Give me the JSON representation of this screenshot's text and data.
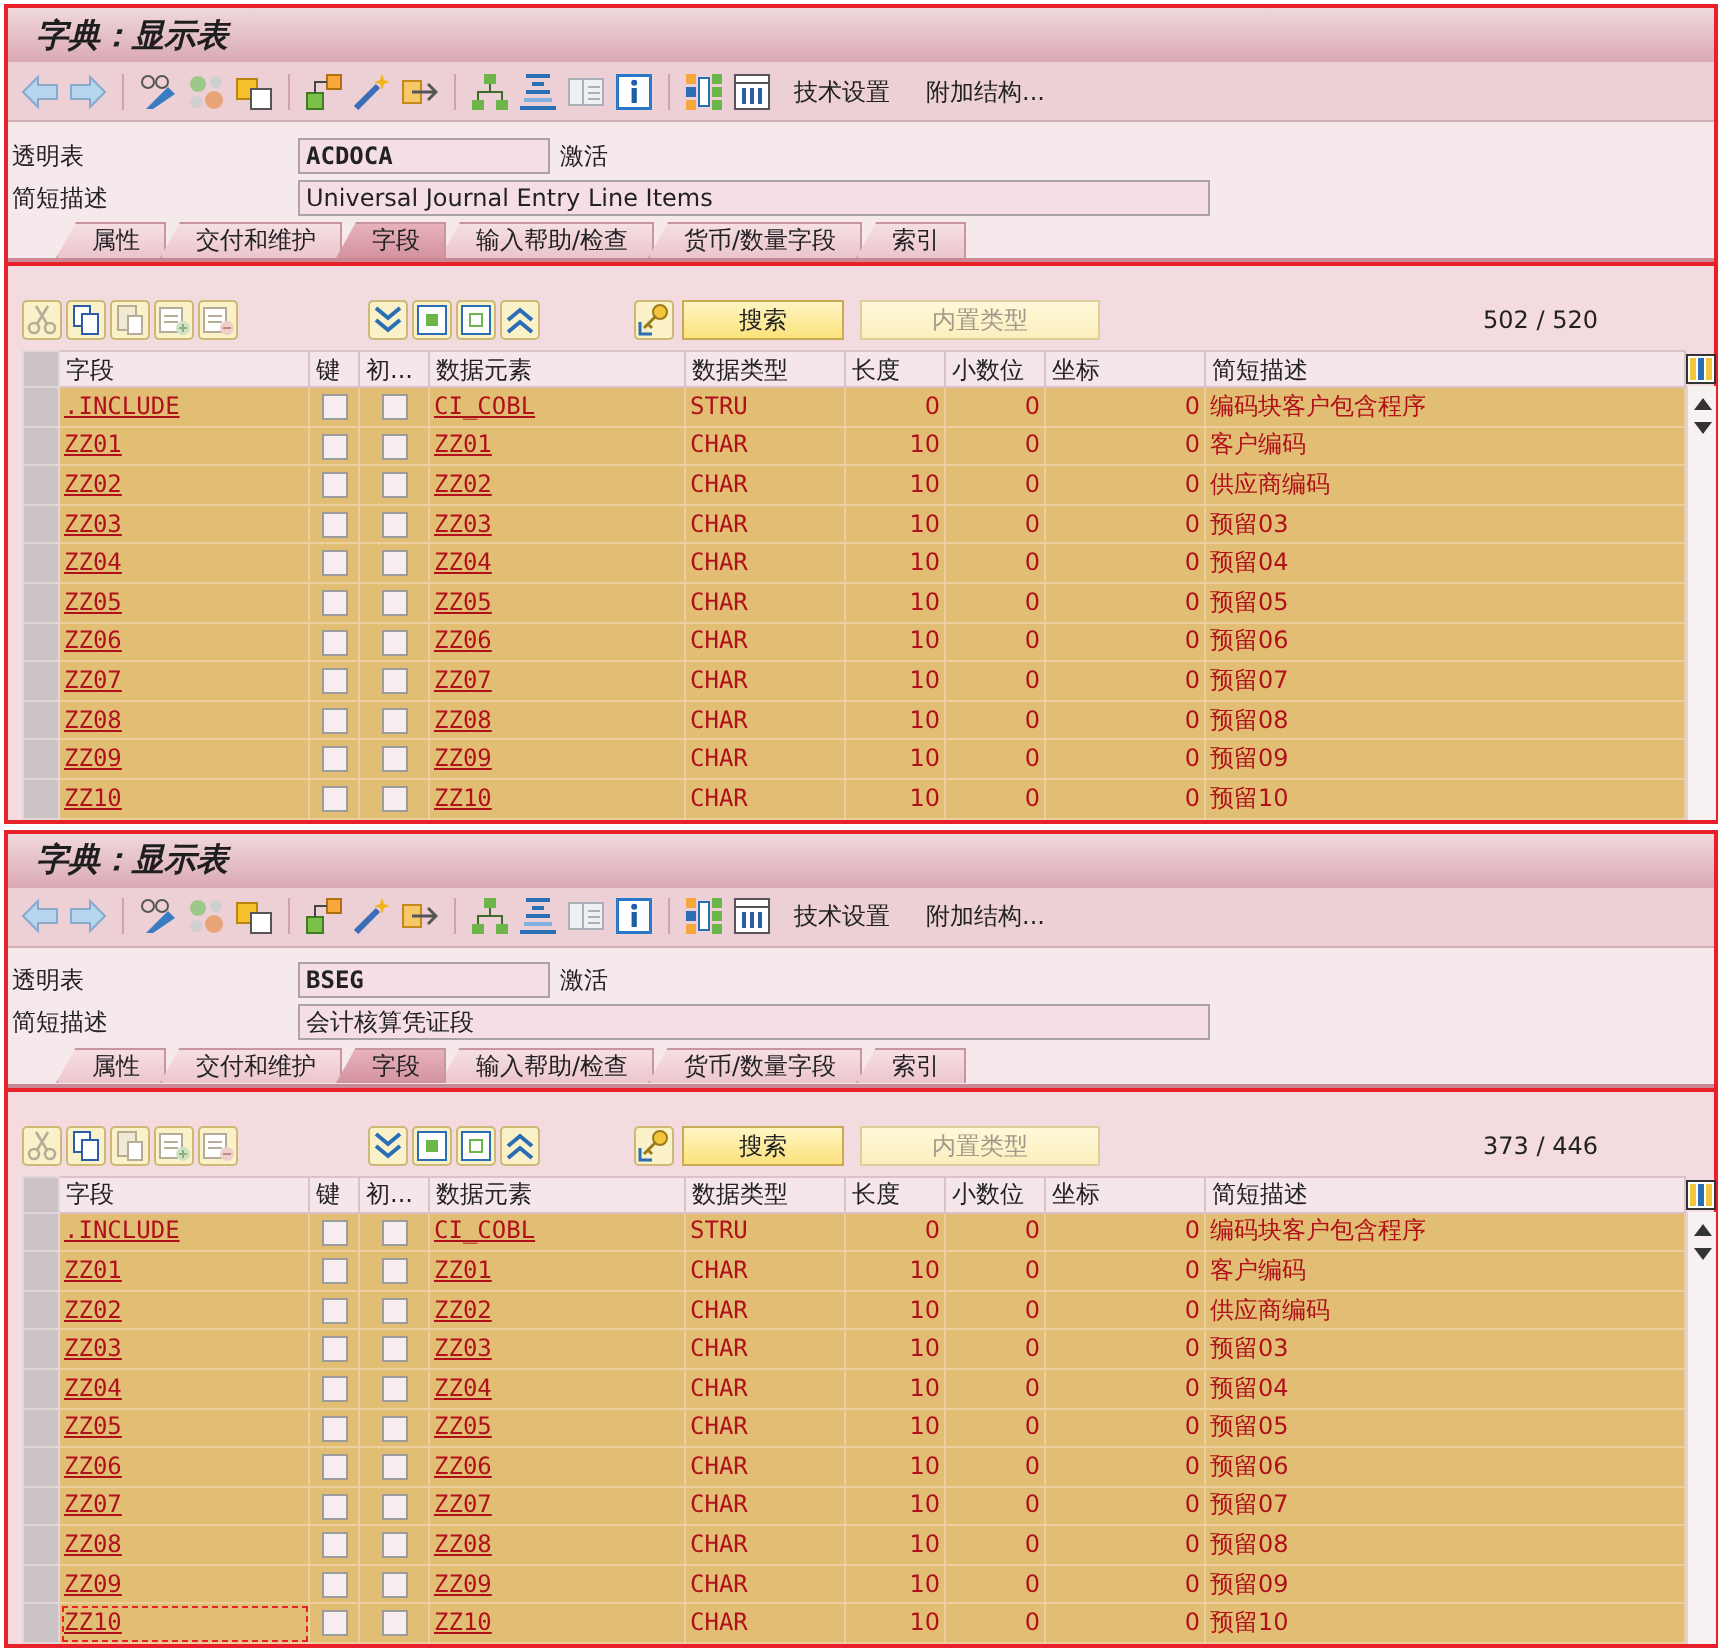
{
  "panels": [
    {
      "window": {
        "title": "字典：显示表"
      },
      "toolbar": {
        "text_buttons": [
          "技术设置",
          "附加结构..."
        ]
      },
      "header": {
        "table_label": "透明表",
        "table_name": "ACDOCA",
        "status": "激活",
        "description_label": "简短描述",
        "description": "Universal Journal Entry Line Items"
      },
      "tabs": [
        {
          "label": "属性",
          "selected": false
        },
        {
          "label": "交付和维护",
          "selected": false
        },
        {
          "label": "字段",
          "selected": true
        },
        {
          "label": "输入帮助/检查",
          "selected": false
        },
        {
          "label": "货币/数量字段",
          "selected": false
        },
        {
          "label": "索引",
          "selected": false
        }
      ],
      "fields_toolbar": {
        "search_button": "搜索",
        "builtin_type_button": {
          "label": "内置类型",
          "disabled": true
        },
        "count": "502 / 520"
      },
      "table": {
        "columns": [
          "字段",
          "键",
          "初...",
          "数据元素",
          "数据类型",
          "长度",
          "小数位",
          "坐标",
          "简短描述"
        ],
        "rows": [
          {
            "field": ".INCLUDE",
            "key": false,
            "initial": false,
            "data_element": "CI_COBL",
            "data_type": "STRU",
            "length": "0",
            "decimals": "0",
            "coordinate": "0",
            "description": "编码块客户包含程序",
            "focused": false
          },
          {
            "field": "ZZ01",
            "key": false,
            "initial": false,
            "data_element": "ZZ01",
            "data_type": "CHAR",
            "length": "10",
            "decimals": "0",
            "coordinate": "0",
            "description": "客户编码",
            "focused": false
          },
          {
            "field": "ZZ02",
            "key": false,
            "initial": false,
            "data_element": "ZZ02",
            "data_type": "CHAR",
            "length": "10",
            "decimals": "0",
            "coordinate": "0",
            "description": "供应商编码",
            "focused": false
          },
          {
            "field": "ZZ03",
            "key": false,
            "initial": false,
            "data_element": "ZZ03",
            "data_type": "CHAR",
            "length": "10",
            "decimals": "0",
            "coordinate": "0",
            "description": "预留03",
            "focused": false
          },
          {
            "field": "ZZ04",
            "key": false,
            "initial": false,
            "data_element": "ZZ04",
            "data_type": "CHAR",
            "length": "10",
            "decimals": "0",
            "coordinate": "0",
            "description": "预留04",
            "focused": false
          },
          {
            "field": "ZZ05",
            "key": false,
            "initial": false,
            "data_element": "ZZ05",
            "data_type": "CHAR",
            "length": "10",
            "decimals": "0",
            "coordinate": "0",
            "description": "预留05",
            "focused": false
          },
          {
            "field": "ZZ06",
            "key": false,
            "initial": false,
            "data_element": "ZZ06",
            "data_type": "CHAR",
            "length": "10",
            "decimals": "0",
            "coordinate": "0",
            "description": "预留06",
            "focused": false
          },
          {
            "field": "ZZ07",
            "key": false,
            "initial": false,
            "data_element": "ZZ07",
            "data_type": "CHAR",
            "length": "10",
            "decimals": "0",
            "coordinate": "0",
            "description": "预留07",
            "focused": false
          },
          {
            "field": "ZZ08",
            "key": false,
            "initial": false,
            "data_element": "ZZ08",
            "data_type": "CHAR",
            "length": "10",
            "decimals": "0",
            "coordinate": "0",
            "description": "预留08",
            "focused": false
          },
          {
            "field": "ZZ09",
            "key": false,
            "initial": false,
            "data_element": "ZZ09",
            "data_type": "CHAR",
            "length": "10",
            "decimals": "0",
            "coordinate": "0",
            "description": "预留09",
            "focused": false
          },
          {
            "field": "ZZ10",
            "key": false,
            "initial": false,
            "data_element": "ZZ10",
            "data_type": "CHAR",
            "length": "10",
            "decimals": "0",
            "coordinate": "0",
            "description": "预留10",
            "focused": false
          }
        ]
      }
    },
    {
      "window": {
        "title": "字典：显示表"
      },
      "toolbar": {
        "text_buttons": [
          "技术设置",
          "附加结构..."
        ]
      },
      "header": {
        "table_label": "透明表",
        "table_name": "BSEG",
        "status": "激活",
        "description_label": "简短描述",
        "description": "会计核算凭证段"
      },
      "tabs": [
        {
          "label": "属性",
          "selected": false
        },
        {
          "label": "交付和维护",
          "selected": false
        },
        {
          "label": "字段",
          "selected": true
        },
        {
          "label": "输入帮助/检查",
          "selected": false
        },
        {
          "label": "货币/数量字段",
          "selected": false
        },
        {
          "label": "索引",
          "selected": false
        }
      ],
      "fields_toolbar": {
        "search_button": "搜索",
        "builtin_type_button": {
          "label": "内置类型",
          "disabled": true
        },
        "count": "373 / 446"
      },
      "table": {
        "columns": [
          "字段",
          "键",
          "初...",
          "数据元素",
          "数据类型",
          "长度",
          "小数位",
          "坐标",
          "简短描述"
        ],
        "rows": [
          {
            "field": ".INCLUDE",
            "key": false,
            "initial": false,
            "data_element": "CI_COBL",
            "data_type": "STRU",
            "length": "0",
            "decimals": "0",
            "coordinate": "0",
            "description": "编码块客户包含程序",
            "focused": false
          },
          {
            "field": "ZZ01",
            "key": false,
            "initial": false,
            "data_element": "ZZ01",
            "data_type": "CHAR",
            "length": "10",
            "decimals": "0",
            "coordinate": "0",
            "description": "客户编码",
            "focused": false
          },
          {
            "field": "ZZ02",
            "key": false,
            "initial": false,
            "data_element": "ZZ02",
            "data_type": "CHAR",
            "length": "10",
            "decimals": "0",
            "coordinate": "0",
            "description": "供应商编码",
            "focused": false
          },
          {
            "field": "ZZ03",
            "key": false,
            "initial": false,
            "data_element": "ZZ03",
            "data_type": "CHAR",
            "length": "10",
            "decimals": "0",
            "coordinate": "0",
            "description": "预留03",
            "focused": false
          },
          {
            "field": "ZZ04",
            "key": false,
            "initial": false,
            "data_element": "ZZ04",
            "data_type": "CHAR",
            "length": "10",
            "decimals": "0",
            "coordinate": "0",
            "description": "预留04",
            "focused": false
          },
          {
            "field": "ZZ05",
            "key": false,
            "initial": false,
            "data_element": "ZZ05",
            "data_type": "CHAR",
            "length": "10",
            "decimals": "0",
            "coordinate": "0",
            "description": "预留05",
            "focused": false
          },
          {
            "field": "ZZ06",
            "key": false,
            "initial": false,
            "data_element": "ZZ06",
            "data_type": "CHAR",
            "length": "10",
            "decimals": "0",
            "coordinate": "0",
            "description": "预留06",
            "focused": false
          },
          {
            "field": "ZZ07",
            "key": false,
            "initial": false,
            "data_element": "ZZ07",
            "data_type": "CHAR",
            "length": "10",
            "decimals": "0",
            "coordinate": "0",
            "description": "预留07",
            "focused": false
          },
          {
            "field": "ZZ08",
            "key": false,
            "initial": false,
            "data_element": "ZZ08",
            "data_type": "CHAR",
            "length": "10",
            "decimals": "0",
            "coordinate": "0",
            "description": "预留08",
            "focused": false
          },
          {
            "field": "ZZ09",
            "key": false,
            "initial": false,
            "data_element": "ZZ09",
            "data_type": "CHAR",
            "length": "10",
            "decimals": "0",
            "coordinate": "0",
            "description": "预留09",
            "focused": false
          },
          {
            "field": "ZZ10",
            "key": false,
            "initial": false,
            "data_element": "ZZ10",
            "data_type": "CHAR",
            "length": "10",
            "decimals": "0",
            "coordinate": "0",
            "description": "预留10",
            "focused": true
          }
        ]
      }
    }
  ]
}
